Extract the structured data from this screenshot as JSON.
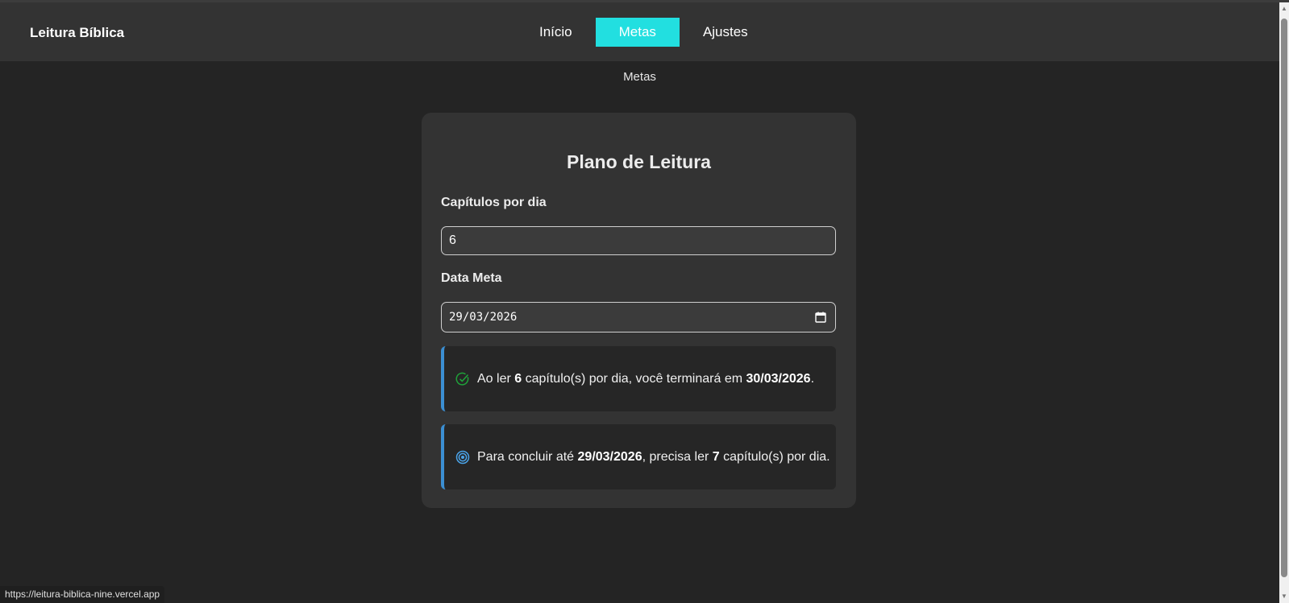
{
  "header": {
    "brand": "Leitura Bíblica",
    "nav": [
      {
        "label": "Início",
        "active": false
      },
      {
        "label": "Metas",
        "active": true
      },
      {
        "label": "Ajustes",
        "active": false
      }
    ],
    "accent_color": "#22dfe0"
  },
  "page": {
    "caption": "Metas"
  },
  "card": {
    "title": "Plano de Leitura",
    "chapters_label": "Capítulos por dia",
    "chapters_value": "6",
    "date_label": "Data Meta",
    "date_value": "29/03/2026",
    "finish_message": {
      "icon": "check-circle-icon",
      "prefix": "Ao ler ",
      "chapters": "6",
      "middle": " capítulo(s) por dia, você terminará em ",
      "date": "30/03/2026",
      "suffix": "."
    },
    "target_message": {
      "icon": "target-icon",
      "prefix": "Para concluir até ",
      "date": "29/03/2026",
      "middle": ", precisa ler ",
      "chapters": "7",
      "suffix": " capítulo(s) por dia."
    },
    "info_border_color": "#3b8fd3"
  },
  "status_bar": {
    "url": "https://leitura-biblica-nine.vercel.app"
  }
}
